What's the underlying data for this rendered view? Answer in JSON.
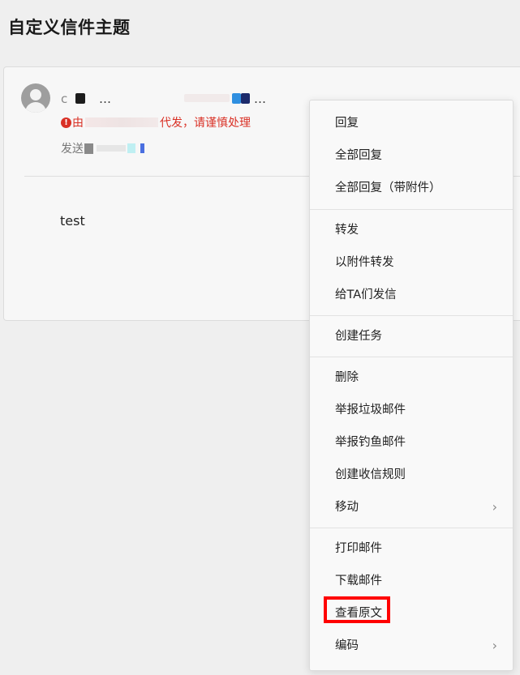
{
  "page": {
    "title": "自定义信件主题"
  },
  "mail": {
    "sender_prefix": "c",
    "sender_ellipsis_1": "…",
    "sender_ellipsis_2": "…",
    "warning_prefix": "由",
    "warning_suffix": "代发，请谨慎处理",
    "warning_icon": "!",
    "send_label": "发送",
    "body": "test"
  },
  "menu": {
    "items": [
      {
        "label": "回复"
      },
      {
        "label": "全部回复"
      },
      {
        "label": "全部回复（带附件）"
      },
      {
        "label": "转发"
      },
      {
        "label": "以附件转发"
      },
      {
        "label": "给TA们发信"
      },
      {
        "label": "创建任务"
      },
      {
        "label": "删除"
      },
      {
        "label": "举报垃圾邮件"
      },
      {
        "label": "举报钓鱼邮件"
      },
      {
        "label": "创建收信规则"
      },
      {
        "label": "移动",
        "submenu_arrow": "›"
      },
      {
        "label": "打印邮件"
      },
      {
        "label": "下载邮件"
      },
      {
        "label": "查看原文"
      },
      {
        "label": "编码",
        "submenu_arrow": "›"
      }
    ]
  },
  "colors": {
    "warning": "#d93025",
    "highlight": "#ff0000"
  }
}
